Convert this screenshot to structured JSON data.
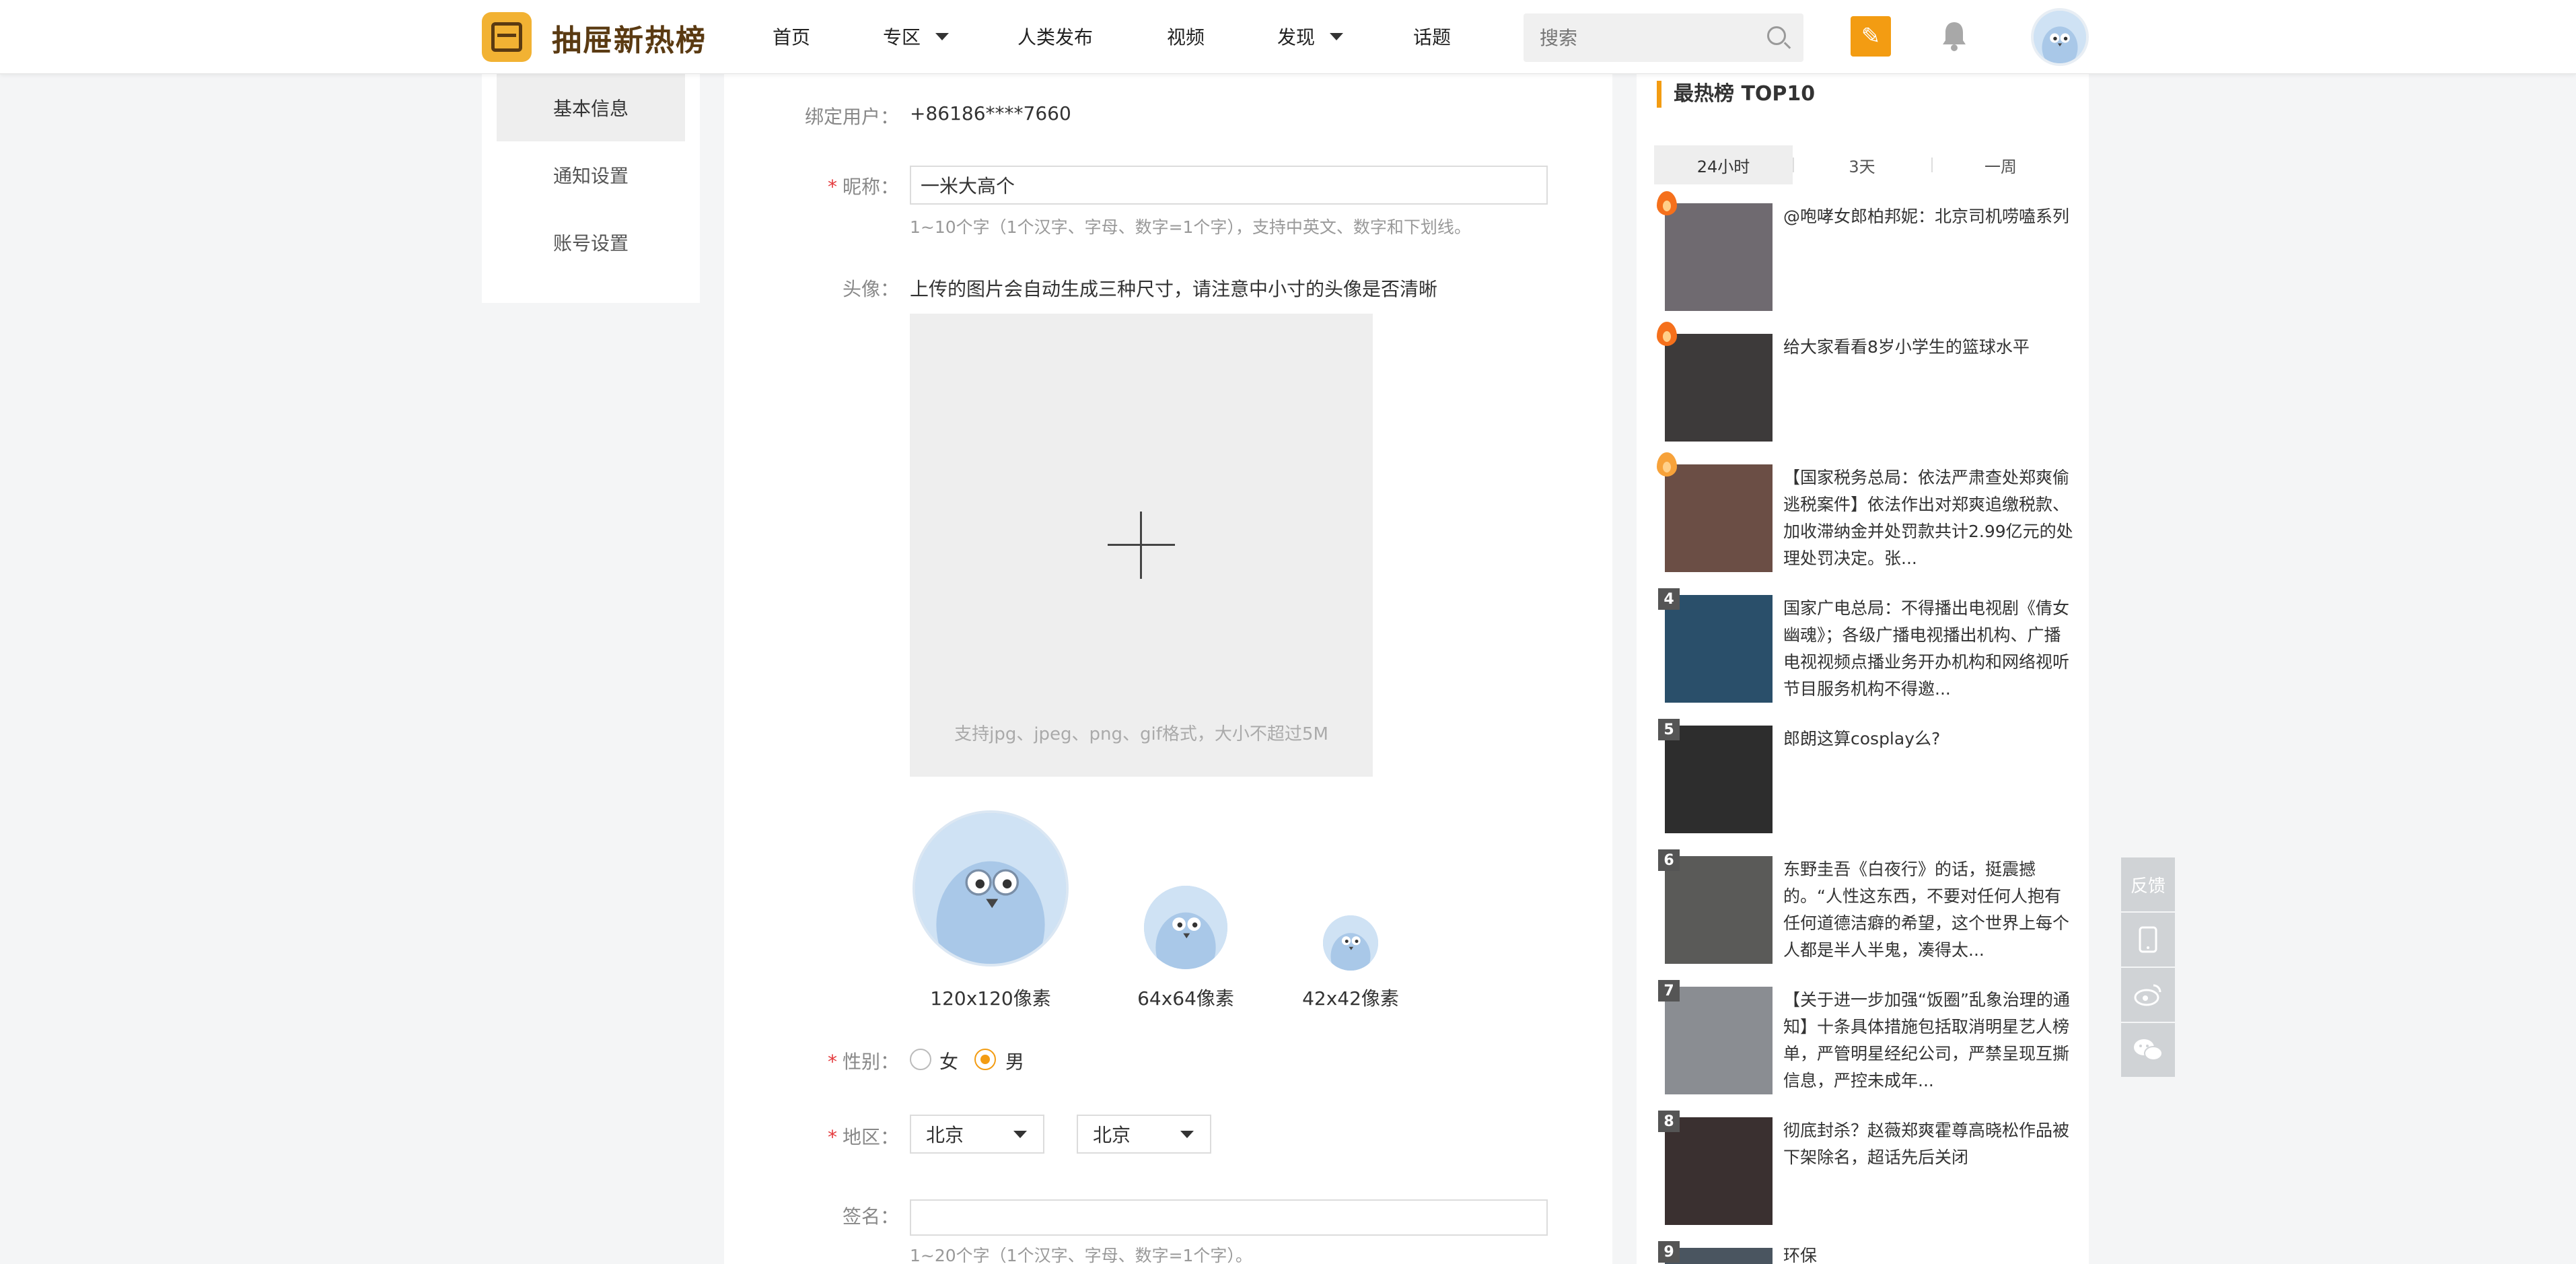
{
  "header": {
    "brand": "抽屉新热榜",
    "nav": [
      {
        "label": "首页",
        "dropdown": false
      },
      {
        "label": "专区",
        "dropdown": true
      },
      {
        "label": "人类发布",
        "dropdown": false
      },
      {
        "label": "视频",
        "dropdown": false
      },
      {
        "label": "发现",
        "dropdown": true
      },
      {
        "label": "话题",
        "dropdown": false
      }
    ],
    "search_placeholder": "搜索",
    "accent": "#f39c12"
  },
  "left_menu": [
    {
      "label": "基本信息",
      "active": true
    },
    {
      "label": "通知设置",
      "active": false
    },
    {
      "label": "账号设置",
      "active": false
    }
  ],
  "form": {
    "bound_user": {
      "label": "绑定用户：",
      "value": "+86186****7660"
    },
    "nickname": {
      "label": "昵称：",
      "value": "一米大高个",
      "hint": "1~10个字（1个汉字、字母、数字=1个字），支持中英文、数字和下划线。"
    },
    "avatar": {
      "label": "头像：",
      "note": "上传的图片会自动生成三种尺寸，请注意中小寸的头像是否清晰",
      "upload_hint": "支持jpg、jpeg、png、gif格式，大小不超过5M",
      "sizes": [
        "120x120像素",
        "64x64像素",
        "42x42像素"
      ]
    },
    "gender": {
      "label": "性别：",
      "options": [
        "女",
        "男"
      ],
      "selected": "男"
    },
    "region": {
      "label": "地区：",
      "province": "北京",
      "city": "北京"
    },
    "signature": {
      "label": "签名：",
      "value": "",
      "hint": "1~20个字（1个汉字、字母、数字=1个字）。"
    }
  },
  "ranking": {
    "title": "最热榜 TOP10",
    "tabs": [
      "24小时",
      "3天",
      "一周"
    ],
    "active_tab": "24小时",
    "items": [
      {
        "rank": "1",
        "text": "@咆哮女郎柏邦妮：北京司机唠嗑系列",
        "thumb": "#6f6a70"
      },
      {
        "rank": "2",
        "text": "给大家看看8岁小学生的篮球水平",
        "thumb": "#3d3a3a"
      },
      {
        "rank": "3",
        "text": "【国家税务总局：依法严肃查处郑爽偷逃税案件】依法作出对郑爽追缴税款、加收滞纳金并处罚款共计2.99亿元的处理处罚决定。张...",
        "thumb": "#6b4e45"
      },
      {
        "rank": "4",
        "text": "国家广电总局：不得播出电视剧《倩女幽魂》；各级广播电视播出机构、广播电视视频点播业务开办机构和网络视听节目服务机构不得邀...",
        "thumb": "#2a4f6a"
      },
      {
        "rank": "5",
        "text": "郎朗这算cosplay么?",
        "thumb": "#2d2d2d"
      },
      {
        "rank": "6",
        "text": "东野圭吾《白夜行》的话，挺震撼的。“人性这东西，不要对任何人抱有任何道德洁癖的希望，这个世界上每个人都是半人半鬼，凑得太...",
        "thumb": "#5a5a58"
      },
      {
        "rank": "7",
        "text": "【关于进一步加强“饭圈”乱象治理的通知】十条具体措施包括取消明星艺人榜单，严管明星经纪公司，严禁呈现互撕信息，严控未成年...",
        "thumb": "#8a8d92"
      },
      {
        "rank": "8",
        "text": "彻底封杀？赵薇郑爽霍尊高晓松作品被下架除名，超话先后关闭",
        "thumb": "#3a3030"
      },
      {
        "rank": "9",
        "text": "环保",
        "thumb": "#4a5560"
      }
    ]
  },
  "side_tools": {
    "feedback": "反馈"
  }
}
